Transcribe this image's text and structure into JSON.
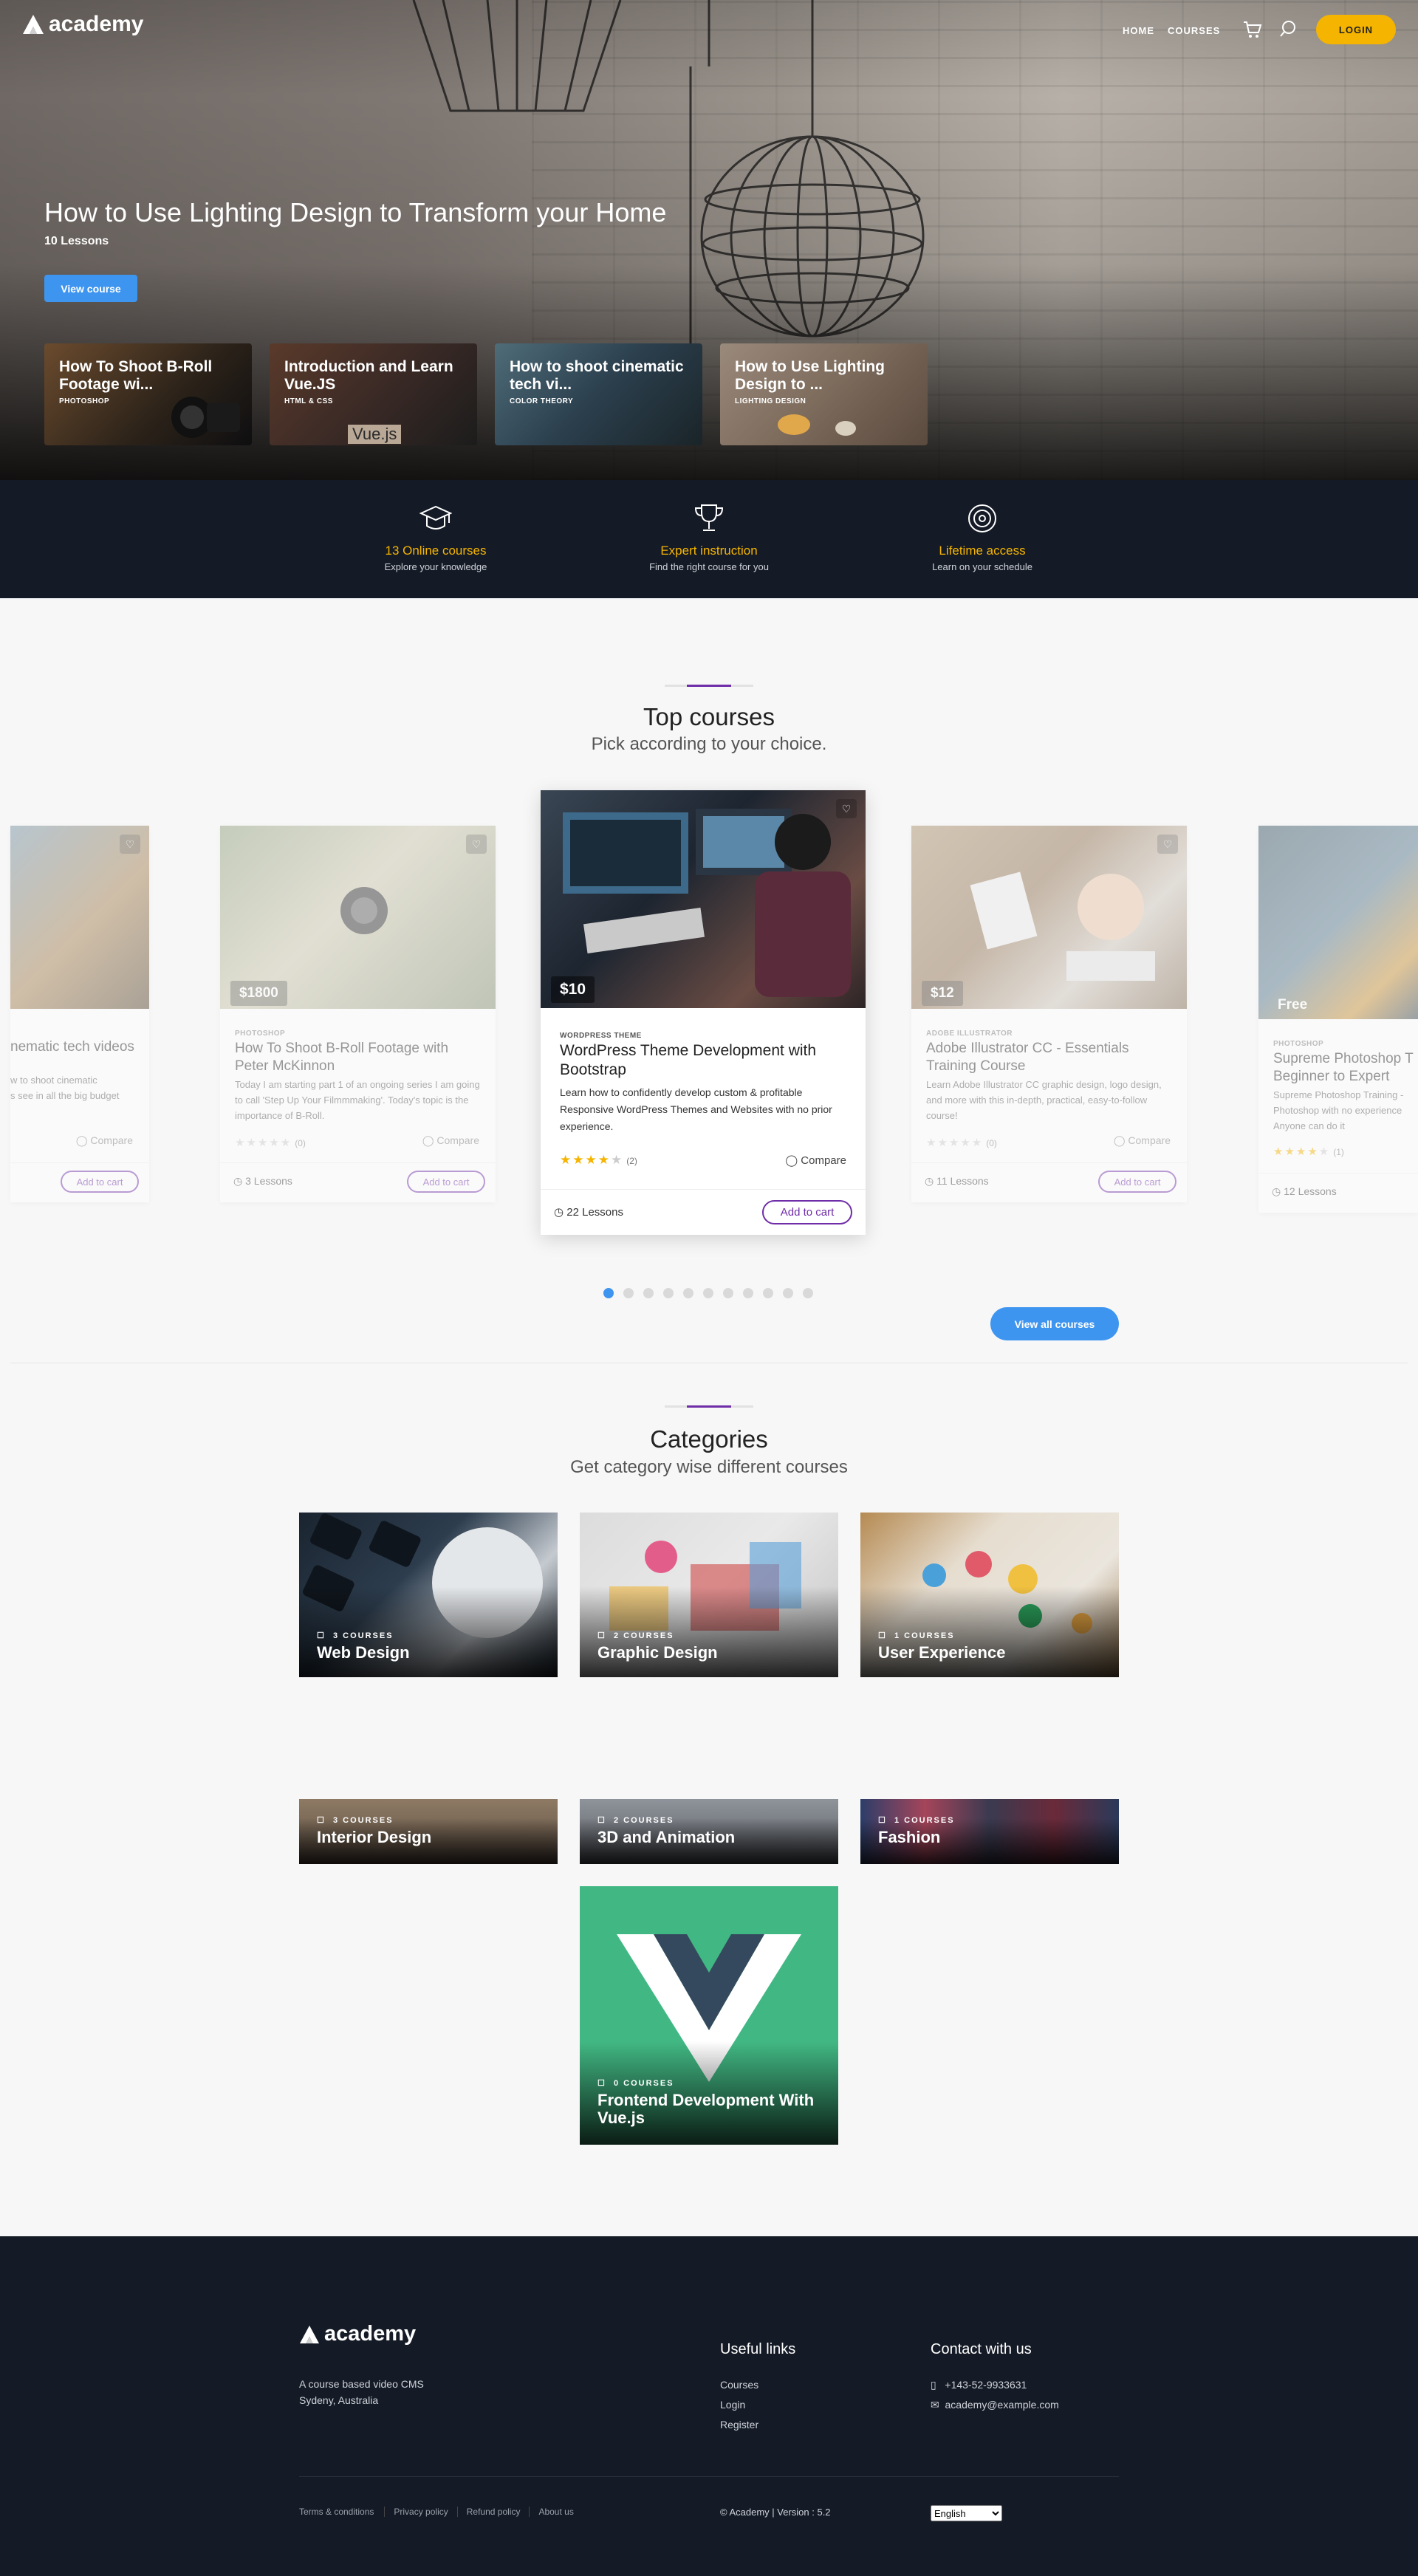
{
  "brand": {
    "name": "academy"
  },
  "nav": {
    "home": "HOME",
    "courses": "COURSES",
    "login": "LOGIN"
  },
  "hero": {
    "title": "How to Use Lighting Design to Transform your Home",
    "lessons": "10 Lessons",
    "button": "View course",
    "slides": [
      {
        "title": "How To Shoot B-Roll Footage wi...",
        "category": "PHOTOSHOP"
      },
      {
        "title": "Introduction and Learn Vue.JS",
        "category": "HTML & CSS",
        "extra": "Vue.js"
      },
      {
        "title": "How to shoot cinematic tech vi...",
        "category": "COLOR THEORY"
      },
      {
        "title": "How to Use Lighting Design to ...",
        "category": "LIGHTING DESIGN"
      }
    ]
  },
  "features": [
    {
      "title": "13 Online courses",
      "subtitle": "Explore your knowledge",
      "icon": "graduation-cap-icon"
    },
    {
      "title": "Expert instruction",
      "subtitle": "Find the right course for you",
      "icon": "trophy-icon"
    },
    {
      "title": "Lifetime access",
      "subtitle": "Learn on your schedule",
      "icon": "target-icon"
    }
  ],
  "top_courses": {
    "title": "Top courses",
    "subtitle": "Pick according to your choice.",
    "view_all": "View all courses",
    "compare_label": "Compare",
    "add_to_cart": "Add to cart",
    "cards": [
      {
        "title": "nematic tech videos",
        "category": "",
        "description": "w to shoot cinematic\ns see in all the big budget",
        "price": "",
        "rating": 0,
        "reviews": "",
        "lessons": ""
      },
      {
        "title": "How To Shoot B-Roll Footage with Peter McKinnon",
        "category": "PHOTOSHOP",
        "description": "Today I am starting part 1 of an ongoing series I am going to call 'Step Up Your Filmmmaking'. Today's topic is the importance of B-Roll.",
        "price": "$1800",
        "rating": 0,
        "reviews": "(0)",
        "lessons": "3 Lessons"
      },
      {
        "title": "WordPress Theme Development with Bootstrap",
        "category": "WORDPRESS THEME",
        "description": "Learn how to confidently develop custom & profitable Responsive WordPress Themes and Websites with no prior experience.",
        "price": "$10",
        "rating": 4,
        "reviews": "(2)",
        "lessons": "22 Lessons"
      },
      {
        "title": "Adobe Illustrator CC - Essentials Training Course",
        "category": "ADOBE ILLUSTRATOR",
        "description": "Learn Adobe Illustrator CC graphic design, logo design, and more with this in-depth, practical, easy-to-follow course!",
        "price": "$12",
        "rating": 0,
        "reviews": "(0)",
        "lessons": "11 Lessons"
      },
      {
        "title": "Supreme Photoshop T Beginner to Expert",
        "category": "PHOTOSHOP",
        "description": "Supreme Photoshop Training - Photoshop with no experience Anyone can do it",
        "price": "Free",
        "rating": 4,
        "reviews": "(1)",
        "lessons": "12 Lessons"
      }
    ],
    "page_count": 11,
    "active_page": 1
  },
  "categories": {
    "title": "Categories",
    "subtitle": "Get category wise different courses",
    "items": [
      {
        "name": "Web Design",
        "count": "3 COURSES"
      },
      {
        "name": "Graphic Design",
        "count": "2 COURSES"
      },
      {
        "name": "User Experience",
        "count": "1 COURSES"
      },
      {
        "name": "Interior Design",
        "count": "3 COURSES"
      },
      {
        "name": "3D and Animation",
        "count": "2 COURSES"
      },
      {
        "name": "Fashion",
        "count": "1 COURSES"
      },
      {
        "name": "Frontend Development With Vue.js",
        "count": "0 COURSES"
      }
    ]
  },
  "footer": {
    "about": "A course based video CMS",
    "location": "Sydeny, Australia",
    "useful_links_title": "Useful links",
    "useful_links": [
      "Courses",
      "Login",
      "Register"
    ],
    "contact_title": "Contact with us",
    "phone": "+143-52-9933631",
    "email": "academy@example.com",
    "bottom_links": [
      "Terms & conditions",
      "Privacy policy",
      "Refund policy",
      "About us"
    ],
    "copyright": "© Academy | Version : 5.2",
    "language": "English"
  },
  "colors": {
    "accent": "#f5b400",
    "primary": "#3e95f0",
    "purple": "#6f2da8",
    "dark": "#151b26"
  }
}
